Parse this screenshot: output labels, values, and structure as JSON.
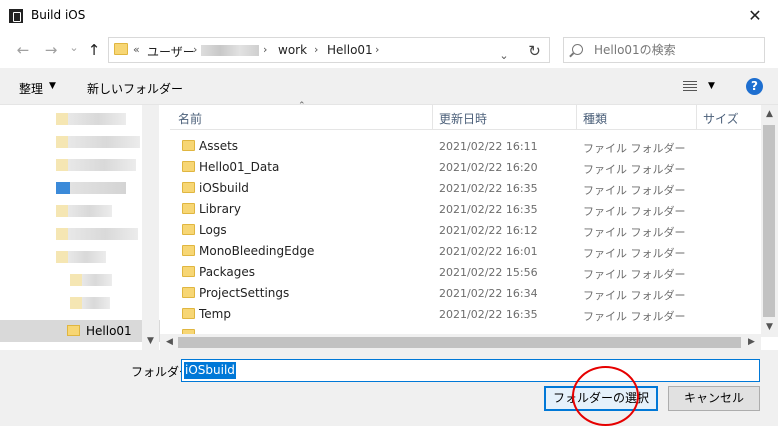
{
  "window": {
    "title": "Build iOS",
    "close_glyph": "✕"
  },
  "nav": {
    "back_glyph": "←",
    "forward_glyph": "→",
    "recent_glyph": "⌄",
    "up_glyph": "↑",
    "breadcrumb": {
      "overflow": "«",
      "items": [
        "ユーザー",
        "work",
        "Hello01"
      ],
      "sep": "›"
    },
    "refresh_glyph": "↻",
    "search_placeholder": "Hello01の検索"
  },
  "toolbar": {
    "organize": "整理",
    "new_folder": "新しいフォルダー",
    "help": "?"
  },
  "tree": {
    "selected": "Hello01"
  },
  "columns": {
    "name": "名前",
    "date": "更新日時",
    "type": "種類",
    "size": "サイズ"
  },
  "files": [
    {
      "name": "Assets",
      "date": "2021/02/22 16:11",
      "type": "ファイル フォルダー"
    },
    {
      "name": "Hello01_Data",
      "date": "2021/02/22 16:20",
      "type": "ファイル フォルダー"
    },
    {
      "name": "iOSbuild",
      "date": "2021/02/22 16:35",
      "type": "ファイル フォルダー"
    },
    {
      "name": "Library",
      "date": "2021/02/22 16:35",
      "type": "ファイル フォルダー"
    },
    {
      "name": "Logs",
      "date": "2021/02/22 16:12",
      "type": "ファイル フォルダー"
    },
    {
      "name": "MonoBleedingEdge",
      "date": "2021/02/22 16:01",
      "type": "ファイル フォルダー"
    },
    {
      "name": "Packages",
      "date": "2021/02/22 15:56",
      "type": "ファイル フォルダー"
    },
    {
      "name": "ProjectSettings",
      "date": "2021/02/22 16:34",
      "type": "ファイル フォルダー"
    },
    {
      "name": "Temp",
      "date": "2021/02/22 16:35",
      "type": "ファイル フォルダー"
    }
  ],
  "folder_field": {
    "label": "フォルダー:",
    "value": "iOSbuild"
  },
  "buttons": {
    "select_folder": "フォルダーの選択",
    "cancel": "キャンセル"
  },
  "colors": {
    "accent": "#0078d7",
    "folder": "#f7d674",
    "annotation": "#e60000"
  }
}
